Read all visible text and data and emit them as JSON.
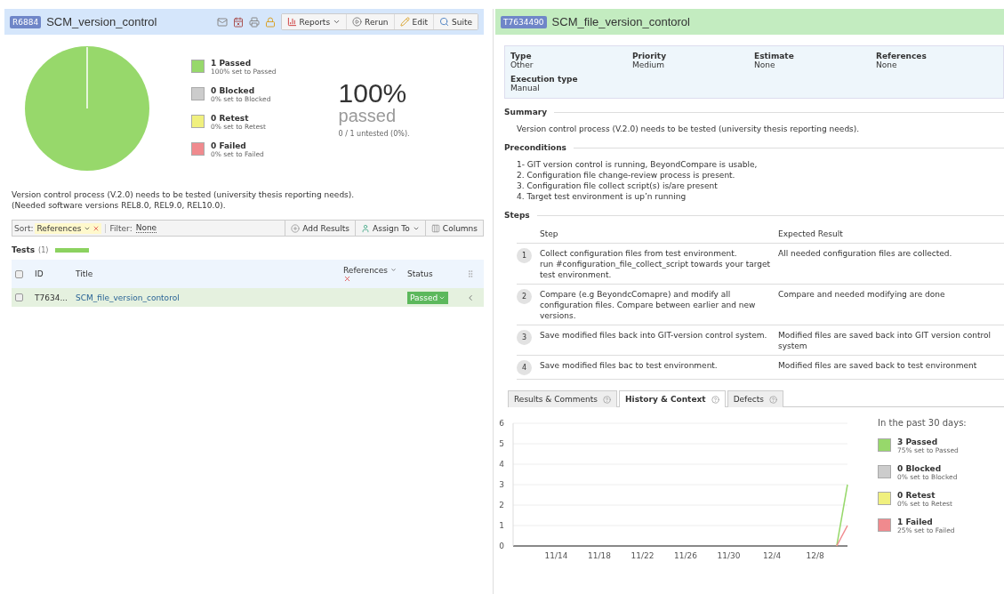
{
  "run": {
    "badge": "R6884",
    "title": "SCM_version_control",
    "buttons": [
      {
        "kind": "reports",
        "label": "Reports"
      },
      {
        "kind": "rerun",
        "label": "Rerun"
      },
      {
        "kind": "edit",
        "label": "Edit"
      },
      {
        "kind": "suite",
        "label": "Suite"
      }
    ],
    "legend": [
      {
        "label": "1 Passed",
        "sub": "100% set to Passed",
        "color": "#97d86b"
      },
      {
        "label": "0 Blocked",
        "sub": "0% set to Blocked",
        "color": "#cccccc"
      },
      {
        "label": "0 Retest",
        "sub": "0% set to Retest",
        "color": "#f0f07e"
      },
      {
        "label": "0 Failed",
        "sub": "0% set to Failed",
        "color": "#f08a8e"
      }
    ],
    "percent": "100%",
    "percent_label": "passed",
    "untested": "0 / 1 untested (0%).",
    "description": [
      "Version control process (V.2.0) needs to be tested (university thesis reporting needs).",
      "(Needed software versions REL8.0, REL9.0, REL10.0)."
    ],
    "toolbar": {
      "sort_label": "Sort:",
      "sort_value": "References",
      "filter_label": "Filter:",
      "filter_value": "None",
      "add_results": "Add Results",
      "assign_to": "Assign To",
      "columns": "Columns"
    },
    "tests": {
      "title": "Tests",
      "count": "(1)",
      "level": 1,
      "all_checked": false,
      "columns": [
        "ID",
        "Title",
        "References",
        "Status"
      ],
      "rows": [
        {
          "id": "T7634...",
          "title": "SCM_file_version_contorol",
          "status": "Passed",
          "checked": false,
          "selected": true
        }
      ]
    }
  },
  "test": {
    "badge": "T7634490",
    "title": "SCM_file_version_contorol",
    "fields": [
      {
        "label": "Type",
        "value": "Other"
      },
      {
        "label": "Priority",
        "value": "Medium"
      },
      {
        "label": "Estimate",
        "value": "None"
      },
      {
        "label": "References",
        "value": "None"
      },
      {
        "label": "Execution type",
        "value": "Manual"
      }
    ],
    "summary": {
      "heading": "Summary",
      "text": "Version control process (V.2.0) needs to be tested (university thesis reporting needs)."
    },
    "preconditions": {
      "heading": "Preconditions",
      "lines": [
        "1- GIT version control is running, BeyondCompare is usable,",
        "2. Configuration file change-review process is present.",
        "3. Configuration file collect script(s) is/are present",
        "4. Target test environment is up’n running"
      ]
    },
    "steps": {
      "heading": "Steps",
      "columns": [
        "Step",
        "Expected Result"
      ],
      "rows": [
        {
          "number": "1",
          "step": "Collect configuration files from test environment.\nrun #configuration_file_collect_script towards your target test environment.",
          "expected": "All needed configuration files are collected."
        },
        {
          "number": "2",
          "step": "Compare (e.g BeyondcComapre) and modify all configuration files. Compare between earlier and new versions.",
          "expected": "Compare and needed modifying are done"
        },
        {
          "number": "3",
          "step": "Save modified files back into GIT-version control system.",
          "expected": "Modified files are saved back into GIT version control system"
        },
        {
          "number": "4",
          "step": "Save modified files bac to test environment.",
          "expected": "Modified files are saved back to test environment"
        }
      ]
    },
    "tabs": [
      {
        "label": "Results & Comments",
        "selected": false
      },
      {
        "label": "History & Context",
        "selected": true
      },
      {
        "label": "Defects",
        "selected": false
      }
    ],
    "history": {
      "chart_data": {
        "type": "line",
        "grid": true,
        "ylim": [
          0,
          6
        ],
        "yticks": [
          0,
          1,
          2,
          3,
          4,
          5,
          6
        ],
        "categories": [
          null,
          null,
          null,
          null,
          "11/14",
          null,
          null,
          null,
          "11/18",
          null,
          null,
          null,
          "11/22",
          null,
          null,
          null,
          "11/26",
          null,
          null,
          null,
          "11/30",
          null,
          null,
          null,
          "12/4",
          null,
          null,
          null,
          "12/8",
          null,
          null,
          null
        ],
        "series": [
          {
            "color": "#97d86b",
            "values": [
              null,
              null,
              null,
              null,
              null,
              null,
              null,
              null,
              null,
              null,
              null,
              null,
              null,
              null,
              null,
              null,
              null,
              null,
              null,
              null,
              null,
              null,
              null,
              null,
              null,
              null,
              null,
              null,
              null,
              null,
              0,
              3
            ]
          },
          {
            "color": "#f08a8e",
            "values": [
              null,
              null,
              null,
              null,
              null,
              null,
              null,
              null,
              null,
              null,
              null,
              null,
              null,
              null,
              null,
              null,
              null,
              null,
              null,
              null,
              null,
              null,
              null,
              null,
              null,
              null,
              null,
              null,
              null,
              null,
              0,
              1
            ]
          }
        ]
      },
      "legend_title": "In the past 30 days:",
      "legend": [
        {
          "label": "3 Passed",
          "sub": "75% set to Passed",
          "color": "#97d86b"
        },
        {
          "label": "0 Blocked",
          "sub": "0% set to Blocked",
          "color": "#cccccc"
        },
        {
          "label": "0 Retest",
          "sub": "0% set to Retest",
          "color": "#f0f07e"
        },
        {
          "label": "1 Failed",
          "sub": "25% set to Failed",
          "color": "#f08a8e"
        }
      ]
    }
  }
}
